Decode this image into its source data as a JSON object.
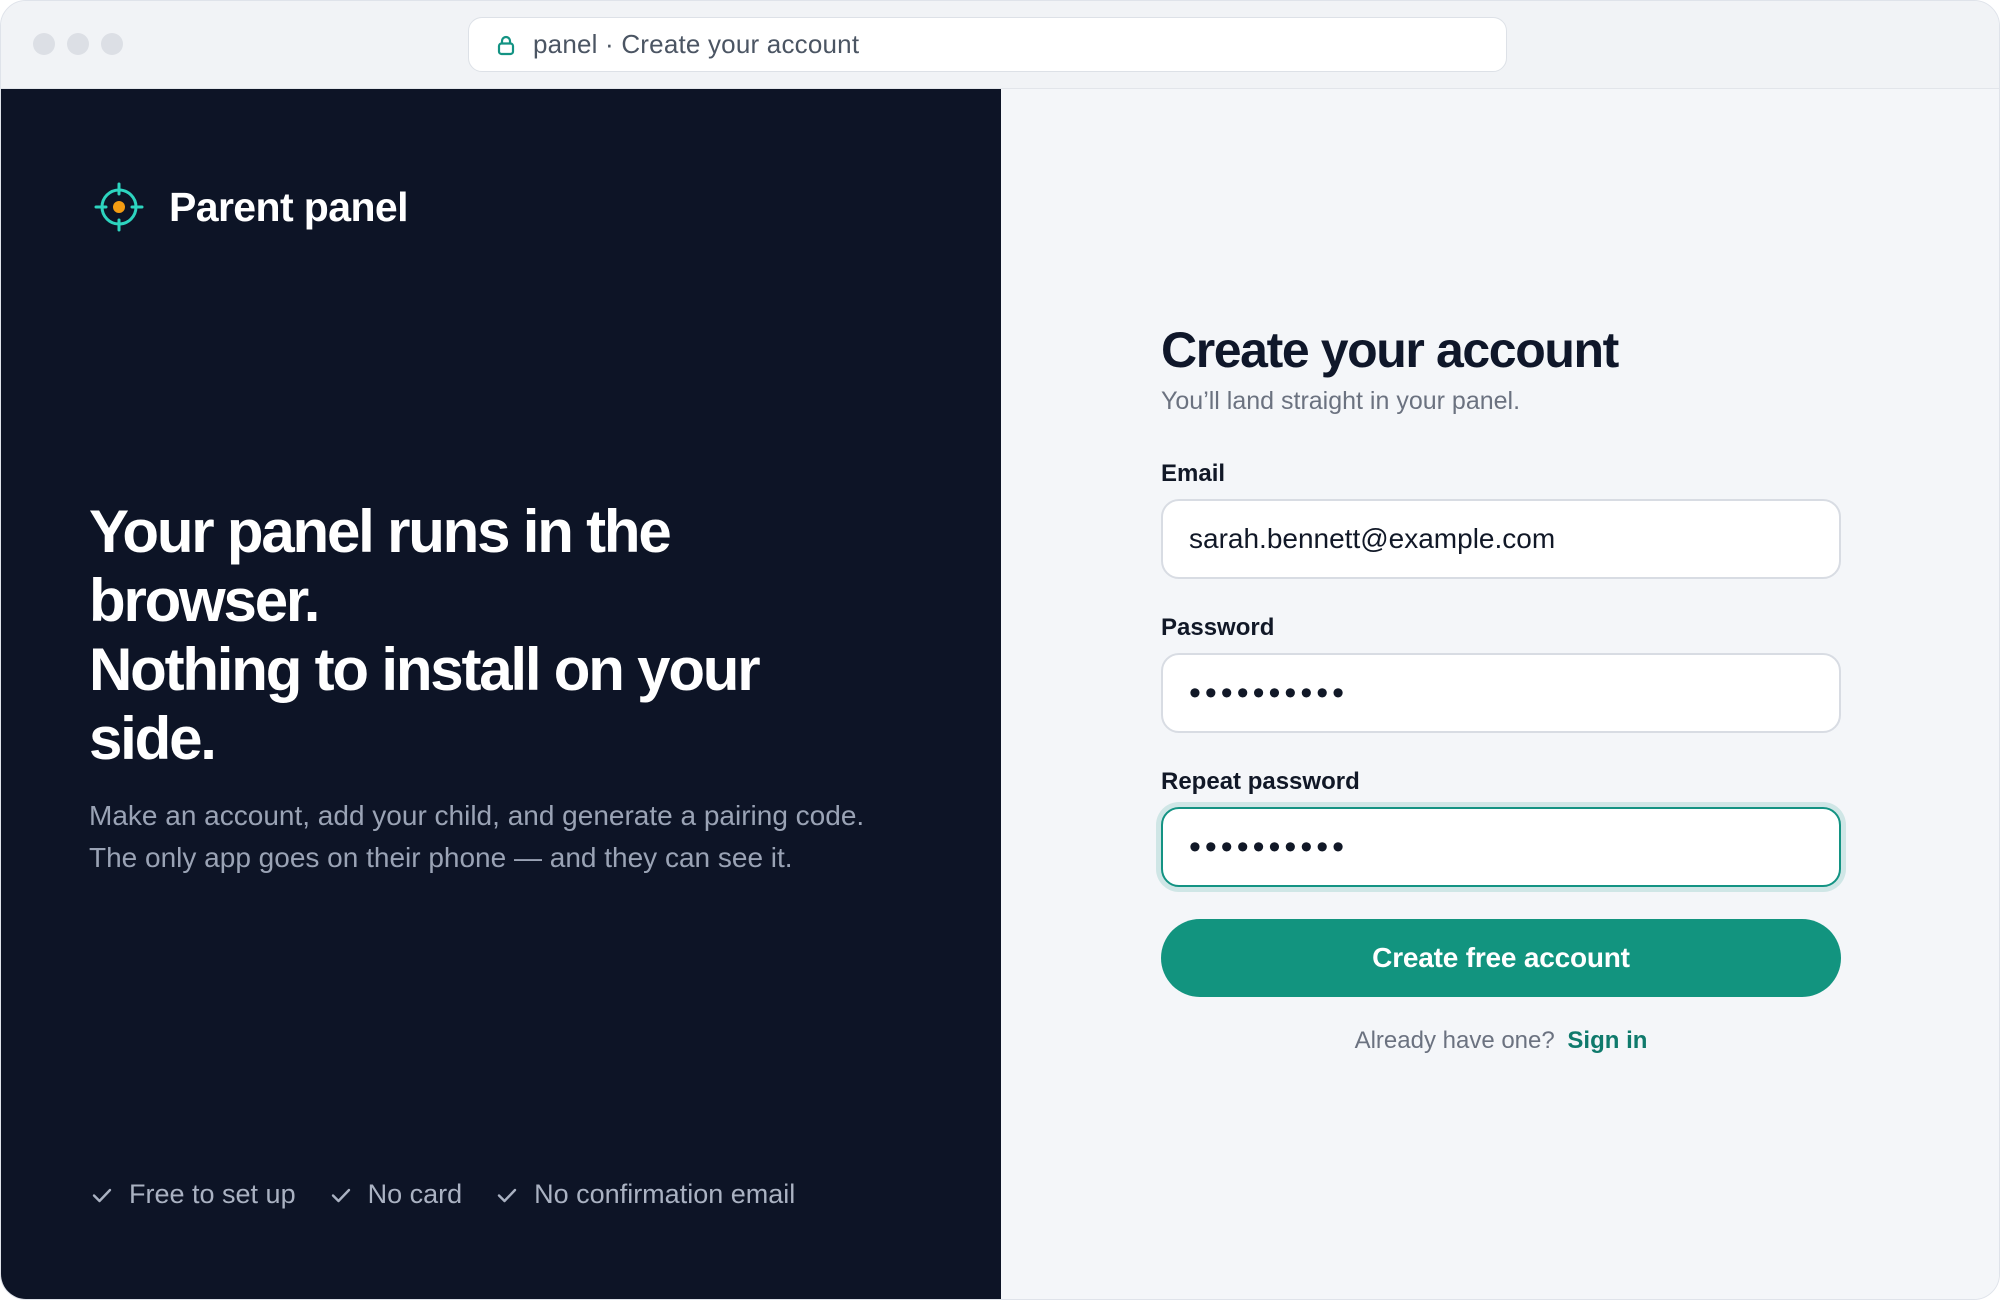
{
  "browser": {
    "url_text": "panel · Create your account",
    "lock_icon": "lock-icon"
  },
  "left": {
    "brand_name": "Parent panel",
    "brand_icon": "crosshair-icon",
    "headline_lines": [
      "Your panel runs in the",
      "browser.",
      "Nothing to install on your",
      "side."
    ],
    "subtext": "Make an account, add your child, and generate a pairing code. The only app goes on their phone — and they can see it.",
    "perks": [
      "Free to set up",
      "No card",
      "No confirmation email"
    ]
  },
  "form": {
    "title": "Create your account",
    "subtitle": "You’ll land straight in your panel.",
    "email_label": "Email",
    "email_value": "sarah.bennett@example.com",
    "password_label": "Password",
    "password_value": "••••••••••",
    "repeat_label": "Repeat password",
    "repeat_value": "••••••••••",
    "submit_label": "Create free account",
    "signin_prompt": "Already have one?",
    "signin_link": "Sign in"
  },
  "colors": {
    "left_bg": "#0d1426",
    "right_bg": "#f4f6f9",
    "accent": "#12947f",
    "brand_orange": "#f39c12",
    "brand_teal": "#2dd4bf"
  }
}
